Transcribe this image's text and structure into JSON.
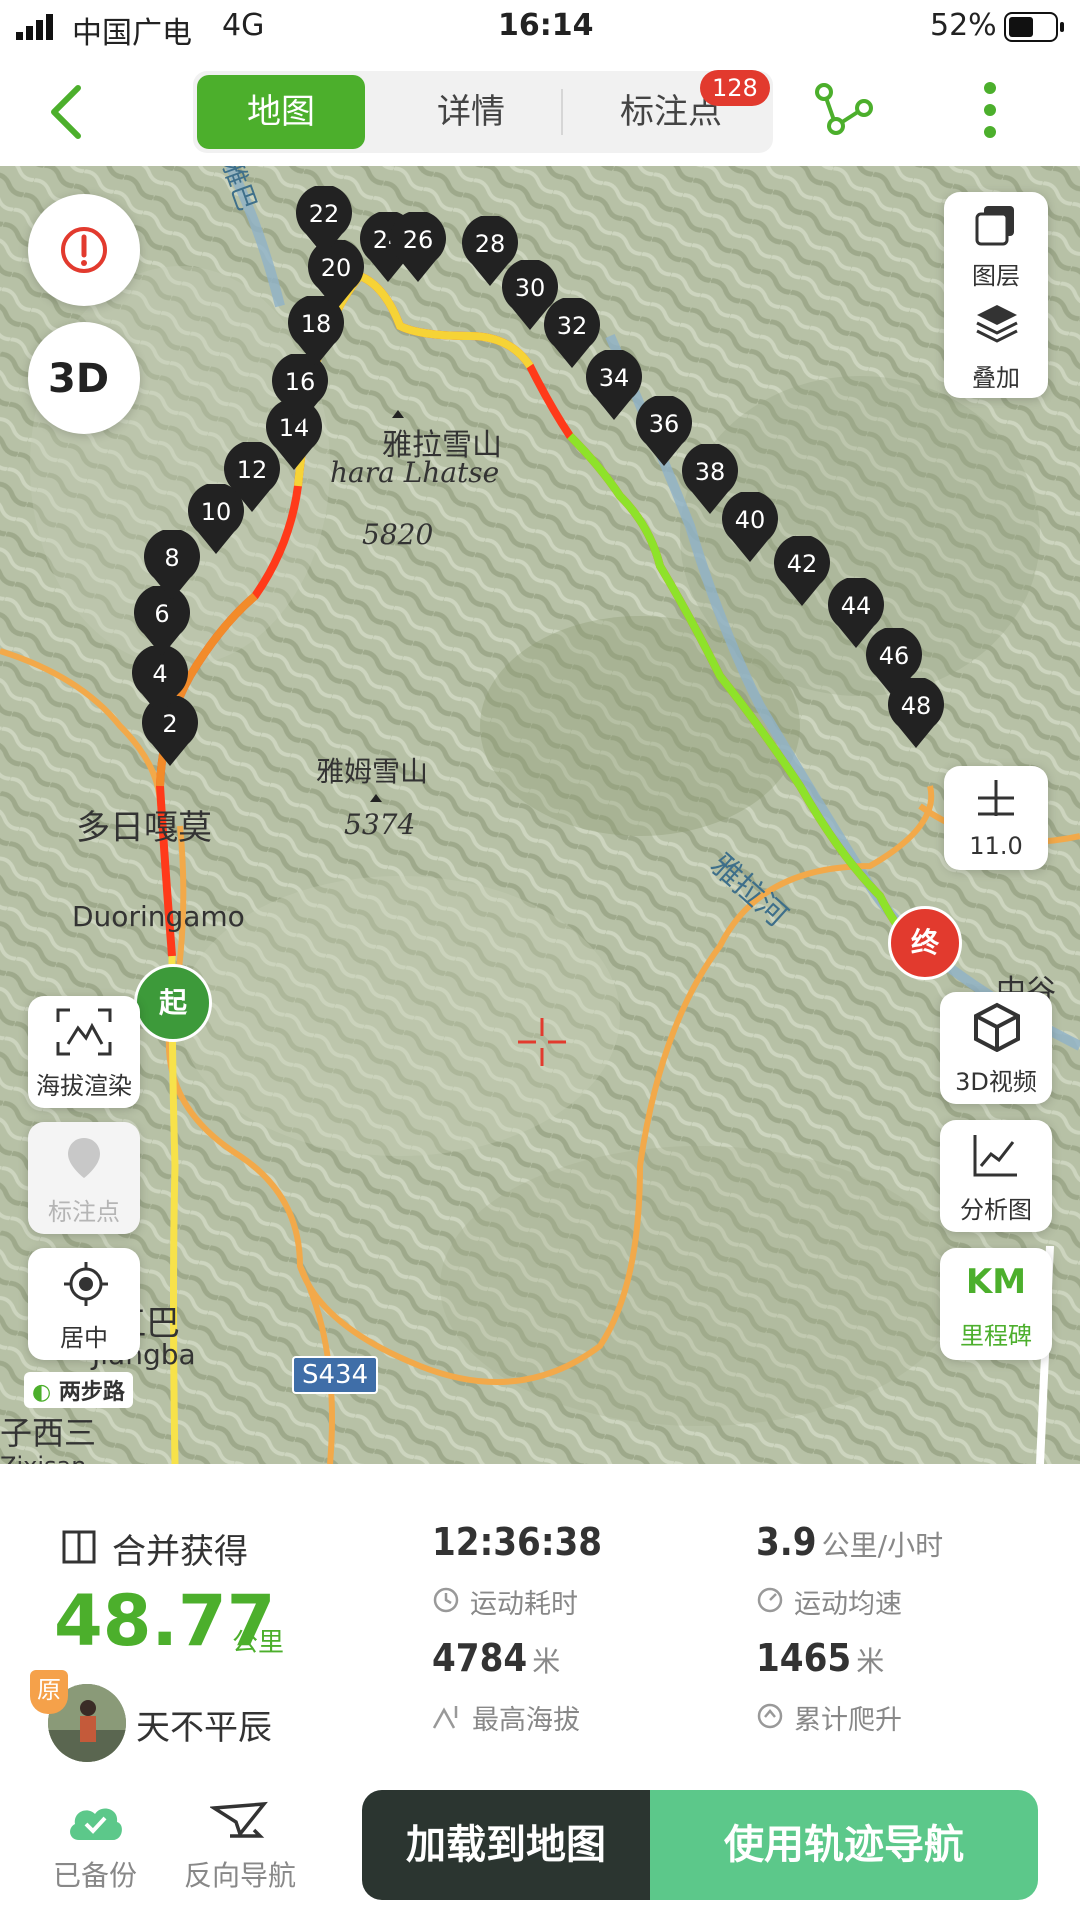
{
  "status_bar": {
    "carrier": "中国广电",
    "network": "4G",
    "time": "16:14",
    "battery": "52%"
  },
  "nav": {
    "tabs": [
      {
        "label": "地图",
        "active": true
      },
      {
        "label": "详情",
        "active": false
      },
      {
        "label": "标注点",
        "active": false
      }
    ],
    "badge": "128",
    "icons": [
      "back-arrow-icon",
      "share-nodes-icon",
      "more-vertical-icon"
    ]
  },
  "map": {
    "labels": {
      "yala_cn": "雅拉雪山",
      "yala_en": "hara Lhatse",
      "yala_elev": "5820",
      "yamu_cn": "雅姆雪山",
      "yamu_elev": "5374",
      "duori_cn": "多日嘎莫",
      "duori_en": "Duoringamo",
      "river": "雅拉河",
      "town_cn": "江巴",
      "town_en": "Jiangba",
      "zhonggu": "中谷村",
      "zixisan": "子西三",
      "zixisan_en": "Zixisan",
      "road": "S434",
      "logo": "两步路",
      "top_partial": "雅巴"
    },
    "markers": [
      "2",
      "4",
      "6",
      "8",
      "10",
      "12",
      "14",
      "16",
      "18",
      "20",
      "22",
      "24",
      "26",
      "28",
      "30",
      "32",
      "34",
      "36",
      "38",
      "40",
      "42",
      "44",
      "46",
      "48"
    ],
    "start_label": "起",
    "end_label": "终",
    "left_buttons": {
      "elevation": "海拔渲染",
      "marker": "标注点",
      "center": "居中"
    },
    "right_buttons": {
      "layers": "图层",
      "overlay": "叠加",
      "zoom_level": "11.0",
      "video3d": "3D视频",
      "analysis": "分析图",
      "km": "KM",
      "milestone": "里程碑"
    }
  },
  "stats": {
    "source": "合并获得",
    "distance": "48.77",
    "distance_unit": "公里",
    "duration": "12:36:38",
    "duration_label": "运动耗时",
    "speed": "3.9",
    "speed_unit": "公里/小时",
    "speed_label": "运动均速",
    "max_alt": "4784",
    "max_alt_unit": "米",
    "max_alt_label": "最高海拔",
    "climb": "1465",
    "climb_unit": "米",
    "climb_label": "累计爬升",
    "user": "天不平辰",
    "origin_badge": "原"
  },
  "actions": {
    "backup": "已备份",
    "reverse": "反向导航",
    "load": "加载到地图",
    "navigate": "使用轨迹导航"
  },
  "colors": {
    "brand_green": "#4caf2c",
    "dark_button": "#2b3530",
    "light_green_button": "#5cc88a",
    "badge_red": "#e23a2e"
  }
}
